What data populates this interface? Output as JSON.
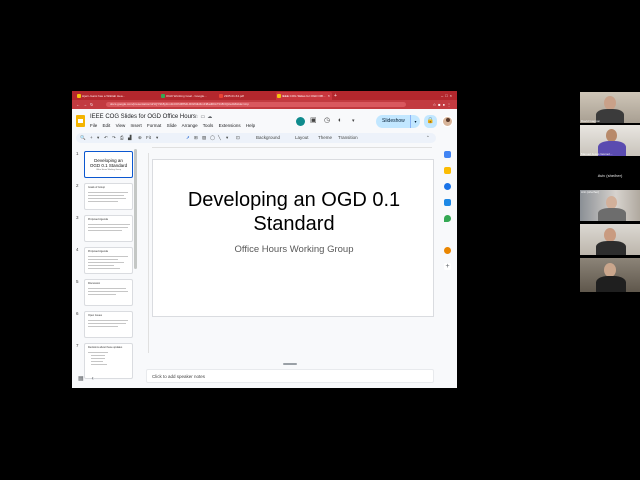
{
  "browser": {
    "tabs": [
      {
        "label": "Hjern-Garsi has a Wikitab Hea...",
        "active": false
      },
      {
        "label": "OGD Working Goal - Google...",
        "active": false
      },
      {
        "label": "2305.01.64.pdf",
        "active": false
      },
      {
        "label": "IEEE COG Slides for OGD Offi...",
        "active": true
      }
    ],
    "url": "docs.google.com/presentation/d/1QY9b8y1lm3n0Oh0f8SD-R0Wdk3tmFt8ad0DnTiC8OQt/edit#slide=id.p"
  },
  "app": {
    "doc_title": "IEEE COG Slides for OGD Office Hours",
    "menu": [
      "File",
      "Edit",
      "View",
      "Insert",
      "Format",
      "Slide",
      "Arrange",
      "Tools",
      "Extensions",
      "Help"
    ],
    "slideshow_label": "Slideshow",
    "toolbar": {
      "zoom_label": "Fit",
      "background_label": "Background",
      "layout_label": "Layout",
      "theme_label": "Theme",
      "transition_label": "Transition"
    },
    "slide": {
      "title": "Developing an OGD 0.1 Standard",
      "subtitle": "Office Hours Working Group"
    },
    "notes_placeholder": "Click to add speaker notes",
    "filmstrip": [
      {
        "num": "1",
        "title": "Developing an OGD 0.1 Standard",
        "subtitle": "Office Hours Working Group"
      },
      {
        "num": "2",
        "title": "Goals of Group"
      },
      {
        "num": "3",
        "title": "Proposed Agenda"
      },
      {
        "num": "4",
        "title": "Proposed Agenda"
      },
      {
        "num": "5",
        "title": "Discussion"
      },
      {
        "num": "6",
        "title": "Open Issues"
      },
      {
        "num": "7",
        "title": "Decisions about these updates"
      }
    ]
  },
  "participants": [
    {
      "name": "David Gagnon",
      "video": true
    },
    {
      "name": "Manuel Jesus Gomez...",
      "video": true
    },
    {
      "name": "Aviv (she/her)",
      "video": false
    },
    {
      "name": "Arin (she/her)",
      "video": true
    },
    {
      "name": "",
      "video": true
    },
    {
      "name": "",
      "video": true
    }
  ]
}
